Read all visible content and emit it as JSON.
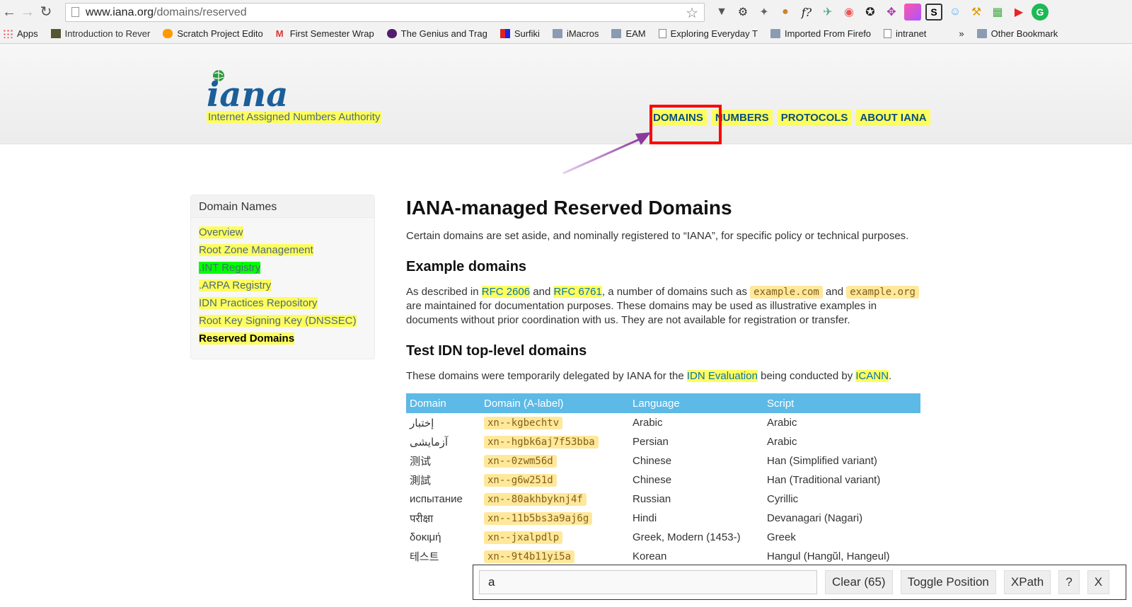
{
  "browser": {
    "url_host": "www.iana.org",
    "url_path": "/domains/reserved",
    "bookmarks": [
      "Apps",
      "Introduction to Rever",
      "Scratch Project Edito",
      "First Semester Wrap",
      "The Genius and Trag",
      "Surfiki",
      "iMacros",
      "EAM",
      "Exploring Everyday T",
      "Imported From Firefo",
      "intranet",
      "Other Bookmark"
    ],
    "more_label": "»"
  },
  "header": {
    "logo_text": "iana",
    "org_name": "Internet Assigned Numbers Authority",
    "nav": [
      "DOMAINS",
      "NUMBERS",
      "PROTOCOLS",
      "ABOUT IANA"
    ]
  },
  "sidebar": {
    "title": "Domain Names",
    "items": [
      "Overview",
      "Root Zone Management",
      ".INT Registry",
      ".ARPA Registry",
      "IDN Practices Repository",
      "Root Key Signing Key (DNSSEC)",
      "Reserved Domains"
    ]
  },
  "main": {
    "title": "IANA-managed Reserved Domains",
    "intro": "Certain domains are set aside, and nominally registered to “IANA”, for specific policy or technical purposes.",
    "example_heading": "Example domains",
    "ex_p1": "As described in ",
    "rfc1": "RFC 2606",
    "ex_and": " and ",
    "rfc2": "RFC 6761",
    "ex_p2": ", a number of domains such as ",
    "code1": "example.com",
    "ex_and2": " and",
    "code2": "example.org",
    "ex_p3": " are maintained for documentation purposes. These domains may be used as illustrative examples in documents without prior coordination with us. They are not available for registration or transfer.",
    "idn_heading": "Test IDN top-level domains",
    "idn_p1": "These domains were temporarily delegated by IANA for the ",
    "idn_link1": "IDN Evaluation",
    "idn_p2": " being conducted by ",
    "idn_link2": "ICANN",
    "idn_p3": ".",
    "table_headers": [
      "Domain",
      "Domain (A-label)",
      "Language",
      "Script"
    ],
    "rows": [
      [
        "إختبار",
        "xn--kgbechtv",
        "Arabic",
        "Arabic"
      ],
      [
        "آزمایشی",
        "xn--hgbk6aj7f53bba",
        "Persian",
        "Arabic"
      ],
      [
        "测试",
        "xn--0zwm56d",
        "Chinese",
        "Han (Simplified variant)"
      ],
      [
        "測試",
        "xn--g6w251d",
        "Chinese",
        "Han (Traditional variant)"
      ],
      [
        "испытание",
        "xn--80akhbyknj4f",
        "Russian",
        "Cyrillic"
      ],
      [
        "परीक्षा",
        "xn--11b5bs3a9aj6g",
        "Hindi",
        "Devanagari (Nagari)"
      ],
      [
        "δοκιμή",
        "xn--jxalpdlp",
        "Greek, Modern (1453-)",
        "Greek"
      ],
      [
        "테스트",
        "xn--9t4b11yi5a",
        "Korean",
        "Hangul (Hangŭl, Hangeul)"
      ]
    ]
  },
  "findbar": {
    "query": "a",
    "clear_label": "Clear (65)",
    "toggle_label": "Toggle Position",
    "xpath_label": "XPath",
    "help_label": "?",
    "close_label": "X"
  }
}
